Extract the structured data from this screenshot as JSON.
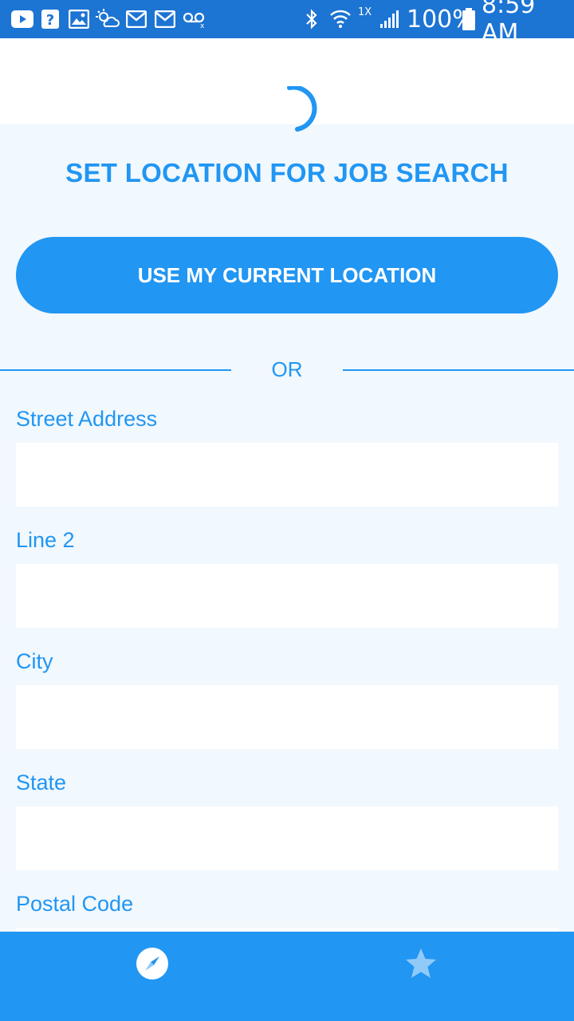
{
  "status_bar": {
    "battery_percent": "100%",
    "time": "8:59 AM",
    "network_label": "1X",
    "left_icons": [
      "youtube-icon",
      "help-icon",
      "image-icon",
      "weather-icon",
      "mail-icon",
      "mail-icon",
      "voicemail-icon"
    ],
    "right_icons": [
      "bluetooth-icon",
      "wifi-icon",
      "signal-icon",
      "battery-icon"
    ]
  },
  "page": {
    "title": "SET LOCATION FOR JOB SEARCH",
    "current_location_button": "USE MY CURRENT LOCATION",
    "or_text": "OR"
  },
  "form": {
    "street_address": {
      "label": "Street Address",
      "value": ""
    },
    "line2": {
      "label": "Line 2",
      "value": ""
    },
    "city": {
      "label": "City",
      "value": ""
    },
    "state": {
      "label": "State",
      "value": ""
    },
    "postal_code": {
      "label": "Postal Code",
      "value": ""
    }
  },
  "bottom_nav": {
    "items": [
      {
        "icon": "compass-icon",
        "active": true
      },
      {
        "icon": "star-icon",
        "active": false
      }
    ]
  },
  "colors": {
    "status_bar": "#1c74d3",
    "accent": "#2196f3",
    "background": "#f1f8fe"
  }
}
